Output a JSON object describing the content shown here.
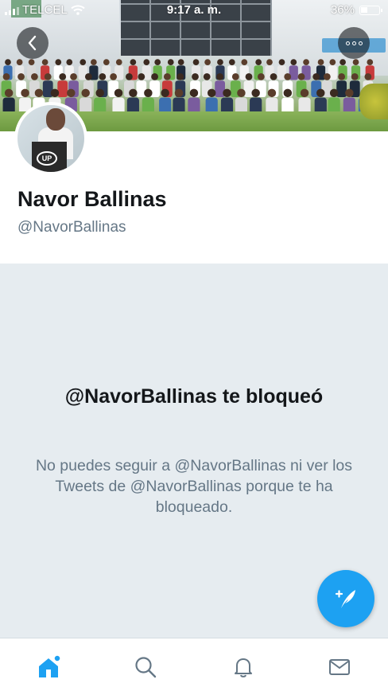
{
  "status_bar": {
    "carrier": "TELCEL",
    "time": "9:17 a. m.",
    "battery": "36%"
  },
  "header": {
    "back_icon": "chevron-left-icon",
    "more_icon": "more-horizontal-icon"
  },
  "profile": {
    "display_name": "Navor Ballinas",
    "handle": "@NavorBallinas"
  },
  "blocked_notice": {
    "title": "@NavorBallinas te bloqueó",
    "description": "No puedes seguir a @NavorBallinas ni ver los Tweets de @NavorBallinas porque te ha bloqueado."
  },
  "compose_button": {
    "icon": "compose-tweet-icon"
  },
  "tab_bar": {
    "items": [
      {
        "icon": "home-icon",
        "active": true
      },
      {
        "icon": "search-icon",
        "active": false
      },
      {
        "icon": "notifications-bell-icon",
        "active": false
      },
      {
        "icon": "messages-envelope-icon",
        "active": false
      }
    ]
  },
  "colors": {
    "accent": "#1da1f2",
    "background": "#e6ecf0",
    "text_primary": "#14171a",
    "text_secondary": "#657786"
  }
}
